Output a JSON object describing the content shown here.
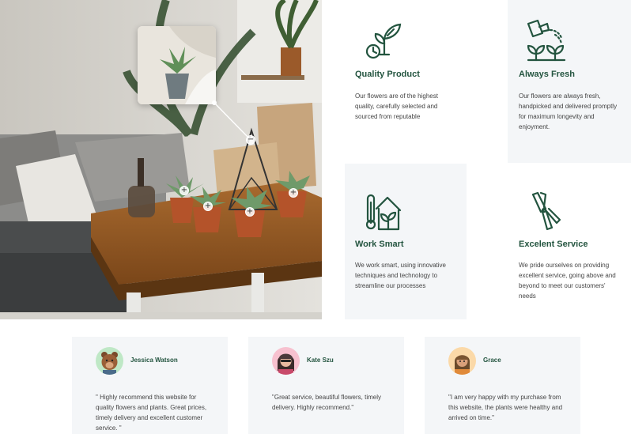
{
  "features": [
    {
      "title": "Quality Product",
      "text": "Our flowers are of the highest quality, carefully selected and sourced from reputable",
      "icon": "plant-clock-icon"
    },
    {
      "title": "Always Fresh",
      "text": "Our flowers are always fresh, handpicked and delivered promptly for maximum longevity and enjoyment.",
      "icon": "watering-can-icon"
    },
    {
      "title": "Work Smart",
      "text": "We work smart, using innovative techniques and technology to streamline our processes",
      "icon": "smart-greenhouse-icon"
    },
    {
      "title": "Excelent Service",
      "text": "We pride ourselves on providing excellent service, going above and beyond to meet our customers' needs",
      "icon": "pruning-shears-icon"
    }
  ],
  "testimonials": [
    {
      "name": "Jessica Watson",
      "quote": "\" Highly recommend this website for quality flowers and plants. Great prices, timely delivery and excellent customer service. \"",
      "avatar_bg": "#bfe8c6"
    },
    {
      "name": "Kate Szu",
      "quote": "\"Great service, beautiful flowers, timely delivery. Highly recommend.\"",
      "avatar_bg": "#f7c1cf"
    },
    {
      "name": "Grace",
      "quote": "\"I am very happy with my purchase from this website, the plants were healthy and arrived on time.\"",
      "avatar_bg": "#fbd9a8"
    }
  ],
  "colors": {
    "accent": "#23543f",
    "card_bg": "#f4f6f8"
  }
}
